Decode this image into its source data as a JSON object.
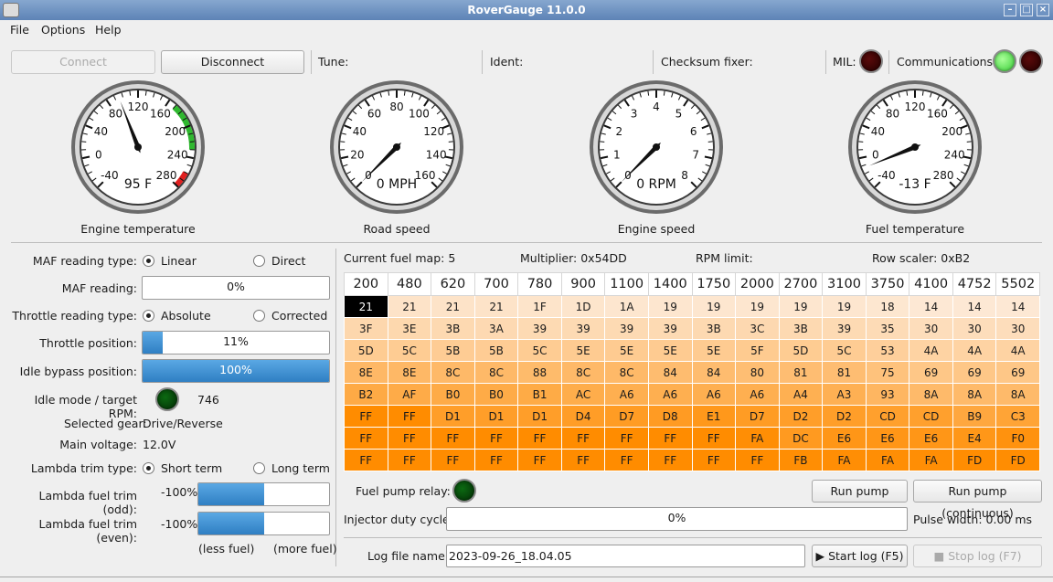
{
  "window": {
    "title": "RoverGauge 11.0.0"
  },
  "menu": [
    "File",
    "Options",
    "Help"
  ],
  "toolbar": {
    "connect": "Connect",
    "disconnect": "Disconnect",
    "tune": "Tune:",
    "ident": "Ident:",
    "checksum": "Checksum fixer:",
    "mil": "MIL:",
    "comms": "Communications:"
  },
  "gauges": [
    {
      "caption": "Engine temperature",
      "readout": "95 F",
      "ticks": [
        "-40",
        "0",
        "40",
        "80",
        "120",
        "160",
        "200",
        "240",
        "280"
      ],
      "min": -40,
      "max": 280,
      "value": 95,
      "redline_from": 260,
      "greenline": [
        170,
        230
      ]
    },
    {
      "caption": "Road speed",
      "readout": "0 MPH",
      "ticks": [
        "0",
        "20",
        "40",
        "60",
        "80",
        "100",
        "120",
        "140",
        "160"
      ],
      "min": 0,
      "max": 160,
      "value": 0
    },
    {
      "caption": "Engine speed",
      "readout": "0 RPM",
      "ticks": [
        "0",
        "1",
        "2",
        "3",
        "4",
        "5",
        "6",
        "7",
        "8"
      ],
      "min": 0,
      "max": 8,
      "value": 0
    },
    {
      "caption": "Fuel temperature",
      "readout": "-13 F",
      "ticks": [
        "-40",
        "0",
        "40",
        "80",
        "120",
        "160",
        "200",
        "240",
        "280"
      ],
      "min": -40,
      "max": 280,
      "value": -13
    }
  ],
  "left": {
    "maf_type": "MAF reading type:",
    "maf_linear": "Linear",
    "maf_direct": "Direct",
    "maf_reading": "MAF reading:",
    "maf_value": "0%",
    "maf_fraction": 0,
    "thr_type": "Throttle reading type:",
    "thr_abs": "Absolute",
    "thr_corr": "Corrected",
    "thr_pos": "Throttle position:",
    "thr_value": "11%",
    "thr_fraction": 0.11,
    "idle_bypass": "Idle bypass position:",
    "idle_value": "100%",
    "idle_fraction": 1.0,
    "idle_mode": "Idle mode / target RPM:",
    "idle_rpm": "746",
    "gear": "Selected gear:",
    "gear_value": "Drive/Reverse",
    "voltage": "Main voltage:",
    "voltage_value": "12.0V",
    "lambda_type": "Lambda trim type:",
    "lambda_short": "Short term",
    "lambda_long": "Long term",
    "lambda_odd": "Lambda fuel trim (odd):",
    "lambda_odd_value": "-100%",
    "lambda_even": "Lambda fuel trim (even):",
    "lambda_even_value": "-100%",
    "less_fuel": "(less fuel)",
    "more_fuel": "(more fuel)"
  },
  "fuelmap": {
    "current": "Current fuel map: 5",
    "multiplier": "Multiplier: 0x54DD",
    "rpm_limit": "RPM limit:",
    "row_scaler": "Row scaler: 0xB2",
    "headers": [
      "200",
      "480",
      "620",
      "700",
      "780",
      "900",
      "1100",
      "1400",
      "1750",
      "2000",
      "2700",
      "3100",
      "3750",
      "4100",
      "4752",
      "5502"
    ],
    "rows": [
      [
        "21",
        "21",
        "21",
        "21",
        "1F",
        "1D",
        "1A",
        "19",
        "19",
        "19",
        "19",
        "19",
        "18",
        "14",
        "14",
        "14"
      ],
      [
        "3F",
        "3E",
        "3B",
        "3A",
        "39",
        "39",
        "39",
        "39",
        "3B",
        "3C",
        "3B",
        "39",
        "35",
        "30",
        "30",
        "30"
      ],
      [
        "5D",
        "5C",
        "5B",
        "5B",
        "5C",
        "5E",
        "5E",
        "5E",
        "5E",
        "5F",
        "5D",
        "5C",
        "53",
        "4A",
        "4A",
        "4A"
      ],
      [
        "8E",
        "8E",
        "8C",
        "8C",
        "88",
        "8C",
        "8C",
        "84",
        "84",
        "80",
        "81",
        "81",
        "75",
        "69",
        "69",
        "69"
      ],
      [
        "B2",
        "AF",
        "B0",
        "B0",
        "B1",
        "AC",
        "A6",
        "A6",
        "A6",
        "A6",
        "A4",
        "A3",
        "93",
        "8A",
        "8A",
        "8A"
      ],
      [
        "FF",
        "FF",
        "D1",
        "D1",
        "D1",
        "D4",
        "D7",
        "D8",
        "E1",
        "D7",
        "D2",
        "D2",
        "CD",
        "CD",
        "B9",
        "C3"
      ],
      [
        "FF",
        "FF",
        "FF",
        "FF",
        "FF",
        "FF",
        "FF",
        "FF",
        "FF",
        "FA",
        "DC",
        "E6",
        "E6",
        "E6",
        "E4",
        "F0"
      ],
      [
        "FF",
        "FF",
        "FF",
        "FF",
        "FF",
        "FF",
        "FF",
        "FF",
        "FF",
        "FF",
        "FB",
        "FA",
        "FA",
        "FA",
        "FD",
        "FD"
      ]
    ],
    "pump": "Fuel pump relay:",
    "run_once": "Run pump (once)",
    "run_cont": "Run pump (continuous)",
    "injector": "Injector duty cycle:",
    "injector_value": "0%",
    "injector_fraction": 0,
    "pulse": "Pulse width: 0.00 ms",
    "log_label": "Log file name:",
    "log_value": "2023-09-26_18.04.05",
    "start_log": "Start log (F5)",
    "stop_log": "Stop log (F7)"
  }
}
